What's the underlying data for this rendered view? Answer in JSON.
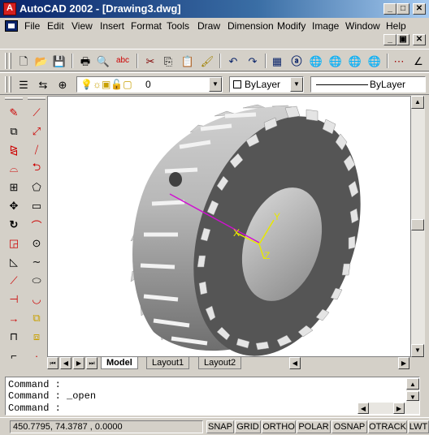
{
  "window": {
    "title": "AutoCAD 2002 - [Drawing3.dwg]",
    "minimize_label": "_",
    "maximize_label": "□",
    "close_label": "✕"
  },
  "menu": {
    "items": [
      "File",
      "Edit",
      "View",
      "Insert",
      "Format",
      "Tools",
      "Draw",
      "Dimension",
      "Modify",
      "Image",
      "Window",
      "Help"
    ],
    "doc_min_label": "_",
    "doc_restore_label": "▣",
    "doc_close_label": "✕"
  },
  "layers": {
    "current_layer": "0",
    "color": "ByLayer",
    "linetype": "ByLayer"
  },
  "layout_tabs": {
    "model": "Model",
    "layout1": "Layout1",
    "layout2": "Layout2"
  },
  "command": {
    "lines": [
      "Command :",
      "Command : _open",
      "Command :"
    ]
  },
  "status": {
    "coords": "450.7795, 74.3787 , 0.0000",
    "buttons": [
      "SNAP",
      "GRID",
      "ORTHO",
      "POLAR",
      "OSNAP",
      "OTRACK",
      "LWT"
    ]
  },
  "ucs": {
    "x_label": "X",
    "y_label": "Y",
    "z_label": "Z"
  },
  "colors": {
    "titlebar": "#0a246a",
    "canvas": "#ffffff",
    "ucs": "#e8e800",
    "axis_line": "#d010d0",
    "gear_body": "#a8a8a8",
    "gear_face": "#505050"
  }
}
